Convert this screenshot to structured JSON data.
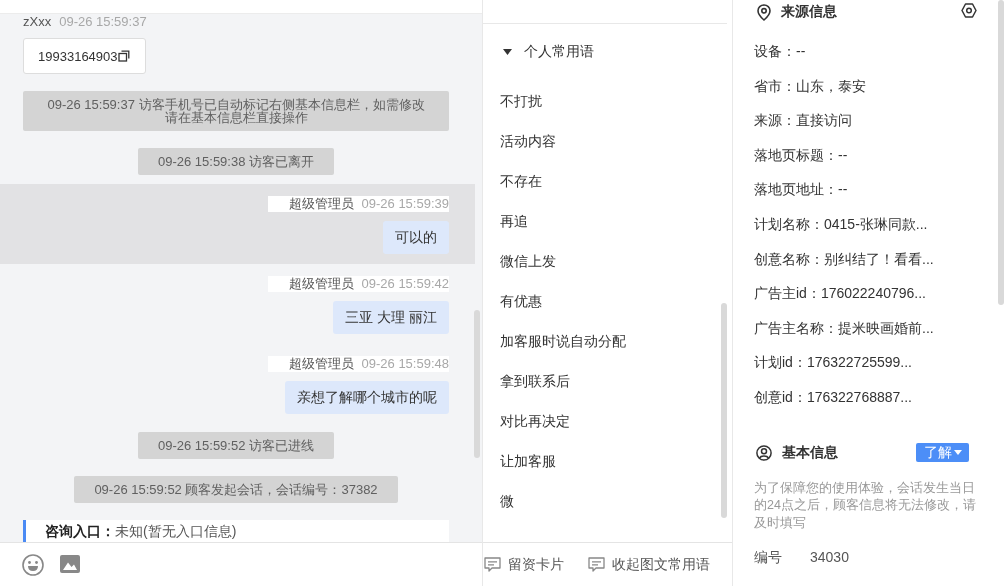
{
  "chat": {
    "messages": [
      {
        "kind": "visitor",
        "sender": "zXxx",
        "time": "09-26 15:59:37",
        "text": "19933164903",
        "highlighted": false
      },
      {
        "kind": "notice",
        "text": "09-26 15:59:37 访客手机号已自动标记右侧基本信息栏，如需修改请在基本信息栏直接操作",
        "highlighted": false
      },
      {
        "kind": "notice",
        "text": "09-26 15:59:38 访客已离开",
        "highlighted": false
      },
      {
        "kind": "agent",
        "sender": "超级管理员",
        "time": "09-26 15:59:39",
        "text": "可以的",
        "highlighted": true
      },
      {
        "kind": "agent",
        "sender": "超级管理员",
        "time": "09-26 15:59:42",
        "text": "三亚 大理 丽江",
        "highlighted": false
      },
      {
        "kind": "agent",
        "sender": "超级管理员",
        "time": "09-26 15:59:48",
        "text": "亲想了解哪个城市的呢",
        "highlighted": false
      },
      {
        "kind": "notice",
        "text": "09-26 15:59:52 访客已进线",
        "highlighted": false
      },
      {
        "kind": "notice",
        "text": "09-26 15:59:52 顾客发起会话，会话编号：37382",
        "highlighted": false
      },
      {
        "kind": "entry",
        "text": "**咨询入口：**未知(暂无入口信息)",
        "highlighted": false
      }
    ]
  },
  "phrases": {
    "group": {
      "title": "个人常用语",
      "expanded": true
    },
    "items": [
      "不打扰",
      "活动内容",
      "不存在",
      "再追",
      "微信上发",
      "有优惠",
      "加客服时说自动分配",
      "拿到联系后",
      "对比再决定",
      "让加客服",
      "微"
    ],
    "actions": [
      "留资卡片",
      "收起图文常用语"
    ]
  },
  "source_info": {
    "title": "来源信息",
    "rows": [
      "设备：--",
      "省市：山东，泰安",
      "来源：直接访问",
      "落地页标题：--",
      "落地页地址：--",
      "计划名称：0415-张琳同款...",
      "创意名称：别纠结了！看看...",
      "广告主id：176022240796...",
      "广告主名称：提米映画婚前...",
      "计划id：176322725599...",
      "创意id：176322768887..."
    ]
  },
  "basic_info": {
    "title": "基本信息",
    "button": "了解",
    "note": "为了保障您的使用体验，会话发生当日的24点之后，顾客信息将无法修改，请及时填写",
    "fields": [
      {
        "label": "编号",
        "value": "34030"
      }
    ]
  }
}
